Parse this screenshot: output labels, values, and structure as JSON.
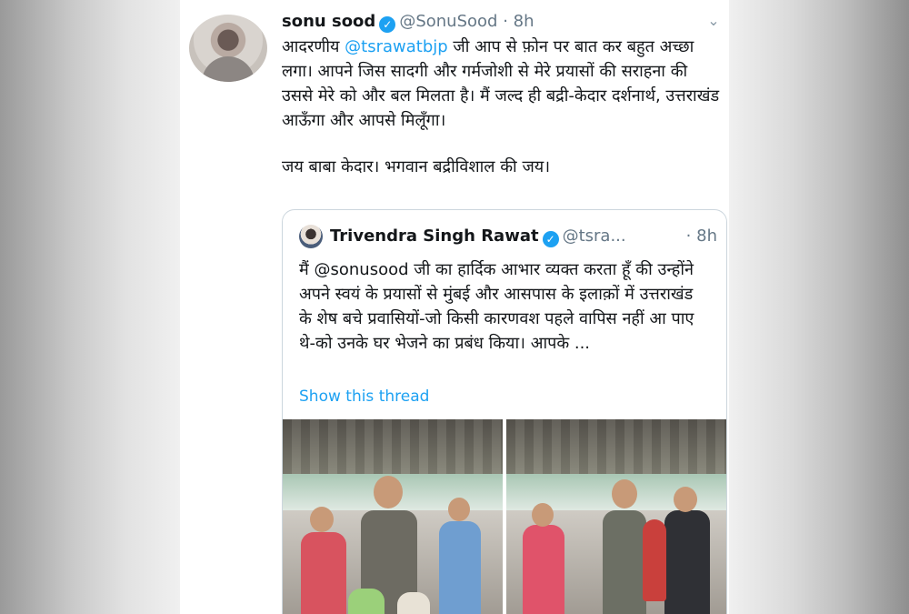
{
  "tweet": {
    "author_name": "sonu sood",
    "author_handle": "@SonuSood",
    "separator": "·",
    "time": "8h",
    "text_prefix": "आदरणीय ",
    "mention": "@tsrawatbjp",
    "text_line1_rest": " जी आप से फ़ोन पर बात कर बहुत अच्छा लगा। आपने जिस सादगी और गर्मजोशी से मेरे प्रयासों की सराहना की उससे मेरे को और बल मिलता है। मैं जल्द ही बद्री-केदार दर्शनार्थ, उत्तराखंड आऊँगा और आपसे मिलूँगा।",
    "text_line2": "जय बाबा केदार। भगवान बद्रीविशाल की जय।"
  },
  "quoted_tweet": {
    "author_name": "Trivendra Singh Rawat",
    "author_handle": "@tsra...",
    "separator": "·",
    "time": "8h",
    "text": "मैं @sonusood जी का हार्दिक आभार व्यक्त करता हूँ की उन्होंने अपने स्वयं के प्रयासों से मुंबई और आसपास के इलाक़ों में उत्तराखंड के शेष बचे प्रवासियों-जो किसी कारणवश पहले वापिस नहीं आ पाए थे-को उनके घर भेजने का प्रबंध किया। आपके ...",
    "show_thread": "Show this thread"
  },
  "icons": {
    "verified": "verified-badge-icon",
    "caret": "chevron-down-icon"
  },
  "colors": {
    "link": "#1da1f2",
    "text": "#14171a",
    "secondary": "#657786",
    "border": "#ccd6dd"
  }
}
